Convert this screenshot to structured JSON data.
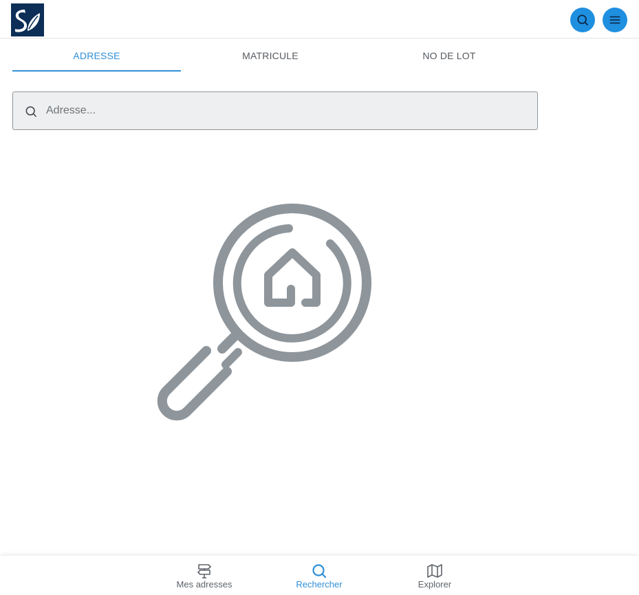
{
  "header": {
    "logo_text": "S",
    "search_button_icon": "search-icon",
    "menu_button_icon": "menu-icon"
  },
  "tabs": [
    {
      "label": "ADRESSE",
      "active": true
    },
    {
      "label": "MATRICULE",
      "active": false
    },
    {
      "label": "NO DE LOT",
      "active": false
    }
  ],
  "search": {
    "placeholder": "Adresse...",
    "value": "",
    "icon": "search-icon"
  },
  "illustration": {
    "icon": "magnifier-house-icon"
  },
  "bottom_nav": {
    "items": [
      {
        "label": "Mes adresses",
        "icon": "signpost-icon",
        "active": false
      },
      {
        "label": "Rechercher",
        "icon": "search-icon",
        "active": true
      },
      {
        "label": "Explorer",
        "icon": "map-icon",
        "active": false
      }
    ]
  },
  "colors": {
    "accent": "#2f8fd8",
    "header_button": "#1f8fe0",
    "logo_bg": "#0c2e57",
    "illustration": "#8e959b",
    "text_muted": "#555a5f"
  }
}
